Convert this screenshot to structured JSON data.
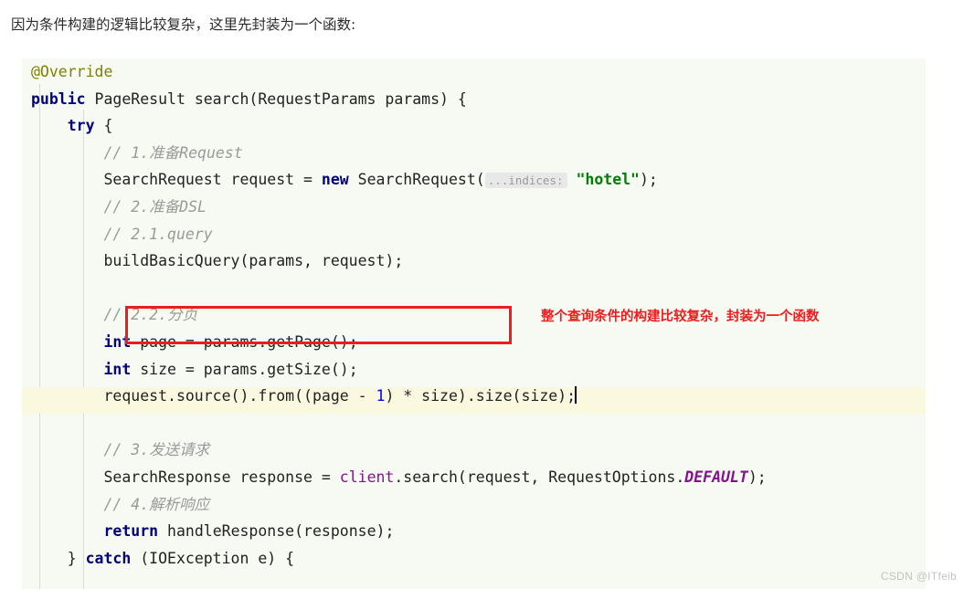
{
  "intro": {
    "text": "因为条件构建的逻辑比较复杂，这里先封装为一个函数:"
  },
  "annotation": {
    "red_note": "整个查询条件的构建比较复杂，封装为一个函数",
    "red_color": "#ee1c1c"
  },
  "watermark": {
    "text": "CSDN @ITfeib"
  },
  "editor": {
    "background": "#f6faf3",
    "current_line_background": "#fbf8e0",
    "language": "java",
    "inlay_hint": "...indices:",
    "lines": [
      {
        "n": 1,
        "tokens": [
          {
            "t": "@Override",
            "c": "anno"
          }
        ]
      },
      {
        "n": 2,
        "tokens": [
          {
            "t": "public",
            "c": "kw"
          },
          {
            "t": " PageResult search(RequestParams params) {",
            "c": "plain"
          }
        ]
      },
      {
        "n": 3,
        "tokens": [
          {
            "t": "    ",
            "c": "plain"
          },
          {
            "t": "try",
            "c": "kw"
          },
          {
            "t": " {",
            "c": "plain"
          }
        ]
      },
      {
        "n": 4,
        "tokens": [
          {
            "t": "        // 1.准备Request",
            "c": "cmt"
          }
        ]
      },
      {
        "n": 5,
        "tokens": [
          {
            "t": "        SearchRequest request = ",
            "c": "plain"
          },
          {
            "t": "new",
            "c": "kw"
          },
          {
            "t": " SearchRequest(",
            "c": "plain"
          },
          {
            "t": "...indices:",
            "c": "hint"
          },
          {
            "t": " ",
            "c": "plain"
          },
          {
            "t": "\"hotel\"",
            "c": "str"
          },
          {
            "t": ");",
            "c": "plain"
          }
        ]
      },
      {
        "n": 6,
        "tokens": [
          {
            "t": "        // 2.准备DSL",
            "c": "cmt"
          }
        ]
      },
      {
        "n": 7,
        "tokens": [
          {
            "t": "        // 2.1.query",
            "c": "cmt"
          }
        ]
      },
      {
        "n": 8,
        "tokens": [
          {
            "t": "        buildBasicQuery(params, request);",
            "c": "plain"
          }
        ]
      },
      {
        "n": 9,
        "tokens": [
          {
            "t": "",
            "c": "plain"
          }
        ]
      },
      {
        "n": 10,
        "tokens": [
          {
            "t": "        // 2.2.分页",
            "c": "cmt"
          }
        ]
      },
      {
        "n": 11,
        "tokens": [
          {
            "t": "        ",
            "c": "plain"
          },
          {
            "t": "int",
            "c": "kw"
          },
          {
            "t": " page = params.getPage();",
            "c": "plain"
          }
        ]
      },
      {
        "n": 12,
        "tokens": [
          {
            "t": "        ",
            "c": "plain"
          },
          {
            "t": "int",
            "c": "kw"
          },
          {
            "t": " size = params.getSize();",
            "c": "plain"
          }
        ]
      },
      {
        "n": 13,
        "tokens": [
          {
            "t": "        request.source().from((page - ",
            "c": "plain"
          },
          {
            "t": "1",
            "c": "num"
          },
          {
            "t": ") * size).size(size);",
            "c": "plain"
          },
          {
            "t": "",
            "c": "caret"
          }
        ]
      },
      {
        "n": 14,
        "tokens": [
          {
            "t": "",
            "c": "plain"
          }
        ]
      },
      {
        "n": 15,
        "tokens": [
          {
            "t": "        // 3.发送请求",
            "c": "cmt"
          }
        ]
      },
      {
        "n": 16,
        "tokens": [
          {
            "t": "        SearchResponse response = ",
            "c": "plain"
          },
          {
            "t": "client",
            "c": "field"
          },
          {
            "t": ".search(request, RequestOptions.",
            "c": "plain"
          },
          {
            "t": "DEFAULT",
            "c": "staticfld"
          },
          {
            "t": ");",
            "c": "plain"
          }
        ]
      },
      {
        "n": 17,
        "tokens": [
          {
            "t": "        // 4.解析响应",
            "c": "cmt"
          }
        ]
      },
      {
        "n": 18,
        "tokens": [
          {
            "t": "        ",
            "c": "plain"
          },
          {
            "t": "return",
            "c": "kw"
          },
          {
            "t": " handleResponse(response);",
            "c": "plain"
          }
        ]
      },
      {
        "n": 19,
        "tokens": [
          {
            "t": "    } ",
            "c": "plain"
          },
          {
            "t": "catch",
            "c": "kw"
          },
          {
            "t": " (IOException e) {",
            "c": "plain"
          }
        ]
      }
    ]
  }
}
